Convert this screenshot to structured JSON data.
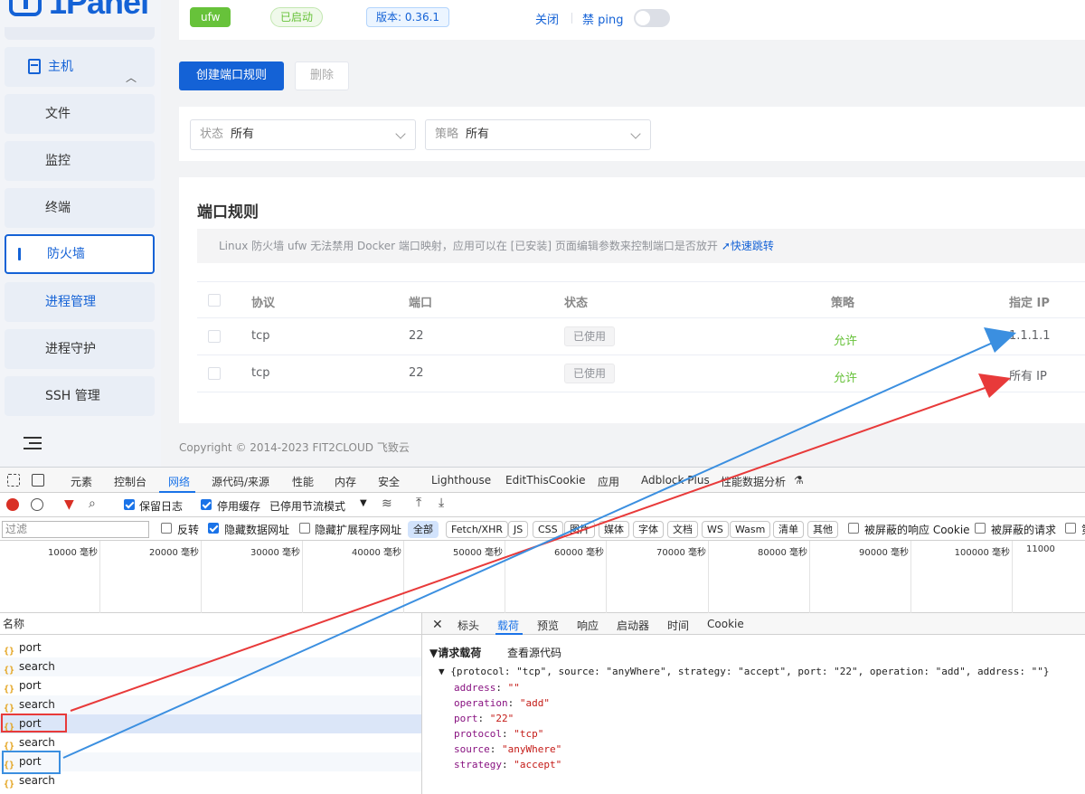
{
  "app": {
    "logo_text": "1Panel",
    "sidebar": {
      "group_label": "主机",
      "items": [
        {
          "label": "文件"
        },
        {
          "label": "监控"
        },
        {
          "label": "终端"
        },
        {
          "label": "防火墙",
          "active": true
        },
        {
          "label": "进程管理"
        },
        {
          "label": "进程守护"
        },
        {
          "label": "SSH 管理"
        }
      ]
    },
    "status": {
      "service_tag": "ufw",
      "running_tag": "已启动",
      "version_tag": "版本: 0.36.1",
      "close_link": "关闭",
      "ping_label": "禁 ping",
      "ping_enabled": false
    },
    "toolbar": {
      "create_label": "创建端口规则",
      "delete_label": "删除"
    },
    "filters": {
      "status_label": "状态",
      "status_value": "所有",
      "strategy_label": "策略",
      "strategy_value": "所有"
    },
    "rules": {
      "title": "端口规则",
      "notice": "Linux 防火墙 ufw 无法禁用 Docker 端口映射，应用可以在 [已安装] 页面编辑参数来控制端口是否放开",
      "notice_link": "快速跳转",
      "columns": [
        "协议",
        "端口",
        "状态",
        "策略",
        "指定 IP"
      ],
      "rows": [
        {
          "protocol": "tcp",
          "port": "22",
          "status": "已使用",
          "strategy": "允许",
          "ip": "1.1.1.1"
        },
        {
          "protocol": "tcp",
          "port": "22",
          "status": "已使用",
          "strategy": "允许",
          "ip": "所有 IP"
        }
      ]
    },
    "footer": "Copyright © 2014-2023 FIT2CLOUD 飞致云"
  },
  "devtools": {
    "tabs": [
      "元素",
      "控制台",
      "网络",
      "源代码/来源",
      "性能",
      "内存",
      "安全",
      "Lighthouse",
      "EditThisCookie",
      "应用",
      "Adblock Plus",
      "性能数据分析"
    ],
    "active_tab": "网络",
    "toolbar": {
      "preserve_log": "保留日志",
      "disable_cache": "停用缓存",
      "throttling": "已停用节流模式"
    },
    "filter_bar": {
      "placeholder": "过滤",
      "invert": "反转",
      "hide_data_urls": "隐藏数据网址",
      "hide_extension_urls": "隐藏扩展程序网址",
      "types": [
        "全部",
        "Fetch/XHR",
        "JS",
        "CSS",
        "图片",
        "媒体",
        "字体",
        "文档",
        "WS",
        "Wasm",
        "清单",
        "其他"
      ],
      "blocked_cookies": "被屏蔽的响应 Cookie",
      "blocked_requests": "被屏蔽的请求",
      "third_party": "第"
    },
    "timeline_ticks": [
      "10000 毫秒",
      "20000 毫秒",
      "30000 毫秒",
      "40000 毫秒",
      "50000 毫秒",
      "60000 毫秒",
      "70000 毫秒",
      "80000 毫秒",
      "90000 毫秒",
      "100000 毫秒",
      "11000"
    ],
    "list_header": "名称",
    "requests": [
      "port",
      "search",
      "port",
      "search",
      "port",
      "search",
      "port",
      "search"
    ],
    "detail": {
      "tabs": [
        "标头",
        "载荷",
        "预览",
        "响应",
        "启动器",
        "时间",
        "Cookie"
      ],
      "active_tab": "载荷",
      "section_title": "▼请求载荷",
      "view_source": "查看源代码",
      "summary": "▼ {protocol: \"tcp\", source: \"anyWhere\", strategy: \"accept\", port: \"22\", operation: \"add\", address: \"\"}",
      "fields": [
        {
          "key": "address",
          "value": "\"\""
        },
        {
          "key": "operation",
          "value": "\"add\""
        },
        {
          "key": "port",
          "value": "\"22\""
        },
        {
          "key": "protocol",
          "value": "\"tcp\""
        },
        {
          "key": "source",
          "value": "\"anyWhere\""
        },
        {
          "key": "strategy",
          "value": "\"accept\""
        }
      ]
    }
  },
  "colors": {
    "primary": "#1462d6",
    "success": "#67c23a",
    "annotation_red": "#e83a3a",
    "annotation_blue": "#3b8fe0"
  }
}
